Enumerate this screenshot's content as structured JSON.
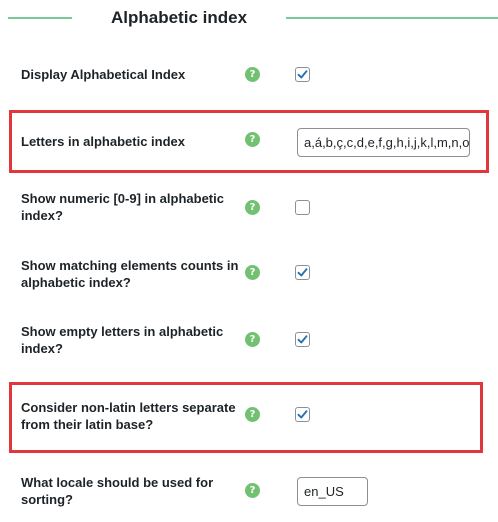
{
  "section": {
    "title": "Alphabetic index"
  },
  "settings": [
    {
      "label": "Display Alphabetical Index",
      "help": "?",
      "type": "checkbox",
      "checked": true
    },
    {
      "label": "Letters in alphabetic index",
      "help": "?",
      "type": "text",
      "value": "a,á,b,ç,c,d,e,f,g,h,i,j,k,l,m,n,o"
    },
    {
      "label": "Show numeric [0-9] in alphabetic index?",
      "help": "?",
      "type": "checkbox",
      "checked": false
    },
    {
      "label": "Show matching elements counts in alphabetic index?",
      "help": "?",
      "type": "checkbox",
      "checked": true
    },
    {
      "label": "Show empty letters in alphabetic index?",
      "help": "?",
      "type": "checkbox",
      "checked": true
    },
    {
      "label": "Consider non-latin letters separate from their latin base?",
      "help": "?",
      "type": "checkbox",
      "checked": true
    },
    {
      "label": "What locale should be used for sorting?",
      "help": "?",
      "type": "text",
      "value": "en_US"
    }
  ],
  "colors": {
    "accent_line": "#78c89a",
    "help_icon": "#72c172",
    "highlight_border": "#e2363d",
    "checkmark": "#2271b1"
  },
  "icons": {
    "help": "question-circle-icon",
    "check": "checkmark-icon"
  }
}
